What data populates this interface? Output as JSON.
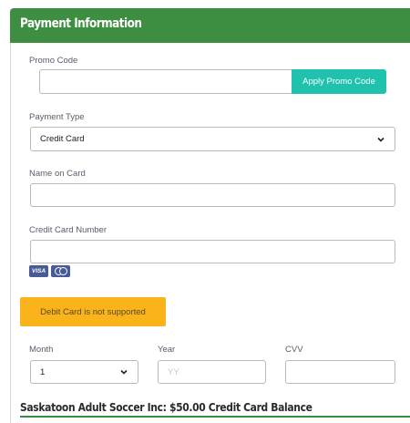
{
  "header": {
    "title": "Payment Information"
  },
  "promo": {
    "label": "Promo Code",
    "value": "",
    "button_label": "Apply Promo Code"
  },
  "payment_type": {
    "label": "Payment Type",
    "selected": "Credit Card"
  },
  "name_on_card": {
    "label": "Name on Card",
    "value": ""
  },
  "card_number": {
    "label": "Credit Card Number",
    "value": "",
    "accepted_icons": [
      "visa-icon",
      "mastercard-icon"
    ],
    "visa_text": "VISA"
  },
  "warning": {
    "text": "Debit Card is not supported",
    "color": "#fbb31b"
  },
  "month": {
    "label": "Month",
    "selected": "1"
  },
  "year": {
    "label": "Year",
    "placeholder": "YY",
    "value": ""
  },
  "cvv": {
    "label": "CVV",
    "value": ""
  },
  "footer": {
    "balance_text": "Saskatoon Adult Soccer Inc: $50.00 Credit Card Balance"
  },
  "colors": {
    "header": "#3e8e41",
    "button": "#20c2ad",
    "card_icon": "#485b96"
  }
}
